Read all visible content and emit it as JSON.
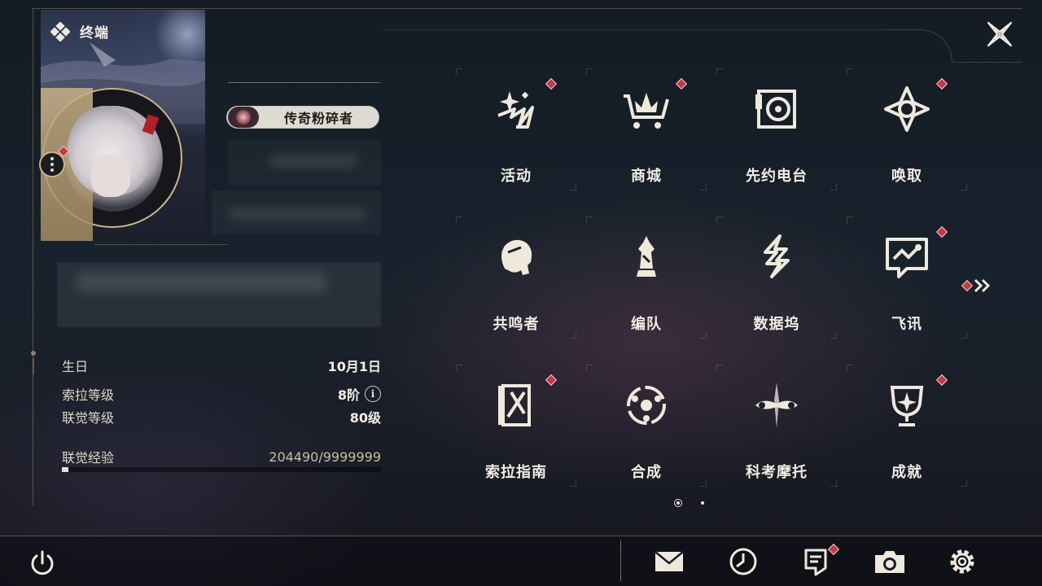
{
  "header": {
    "title": "终端",
    "title_icon": "terminal-diamond-icon",
    "close_icon": "close-icon"
  },
  "profile": {
    "player_title": "传奇粉碎者",
    "menu_icon": "more-vertical-icon",
    "stats": [
      {
        "label": "生日",
        "value": "10月1日"
      },
      {
        "label": "索拉等级",
        "value": "8阶",
        "info_icon": "info-icon"
      },
      {
        "label": "联觉等级",
        "value": "80级"
      }
    ],
    "exp": {
      "label": "联觉经验",
      "value": "204490/9999999",
      "progress": 0.0204
    }
  },
  "menu_grid": {
    "items": [
      {
        "label": "活动",
        "icon": "sparkle-icon",
        "badge": true
      },
      {
        "label": "商城",
        "icon": "shop-cart-icon",
        "badge": true
      },
      {
        "label": "先约电台",
        "icon": "radio-icon",
        "badge": false
      },
      {
        "label": "唤取",
        "icon": "convene-icon",
        "badge": true
      },
      {
        "label": "共鸣者",
        "icon": "resonator-icon",
        "badge": false
      },
      {
        "label": "编队",
        "icon": "chess-icon",
        "badge": false
      },
      {
        "label": "数据坞",
        "icon": "data-bank-icon",
        "badge": false
      },
      {
        "label": "飞讯",
        "icon": "chat-icon",
        "badge": true
      },
      {
        "label": "索拉指南",
        "icon": "guidebook-icon",
        "badge": true
      },
      {
        "label": "合成",
        "icon": "synthesis-icon",
        "badge": false
      },
      {
        "label": "科考摩托",
        "icon": "motorcycle-icon",
        "badge": false
      },
      {
        "label": "成就",
        "icon": "trophy-icon",
        "badge": true
      }
    ],
    "next_icon": "double-chevron-right-icon",
    "pages": 2,
    "current_page": 1
  },
  "bottom_bar": {
    "power_icon": "power-icon",
    "buttons": [
      {
        "icon": "mail-icon",
        "badge": false
      },
      {
        "icon": "clock-icon",
        "badge": false
      },
      {
        "icon": "notice-icon",
        "badge": true
      },
      {
        "icon": "camera-icon",
        "badge": false
      },
      {
        "icon": "settings-gear-icon",
        "badge": false
      }
    ]
  },
  "colors": {
    "accent_gold": "#c9b48a",
    "badge_red": "#c23a4a",
    "text_light": "#f1ece3",
    "exp_value": "#cbbf9f"
  }
}
